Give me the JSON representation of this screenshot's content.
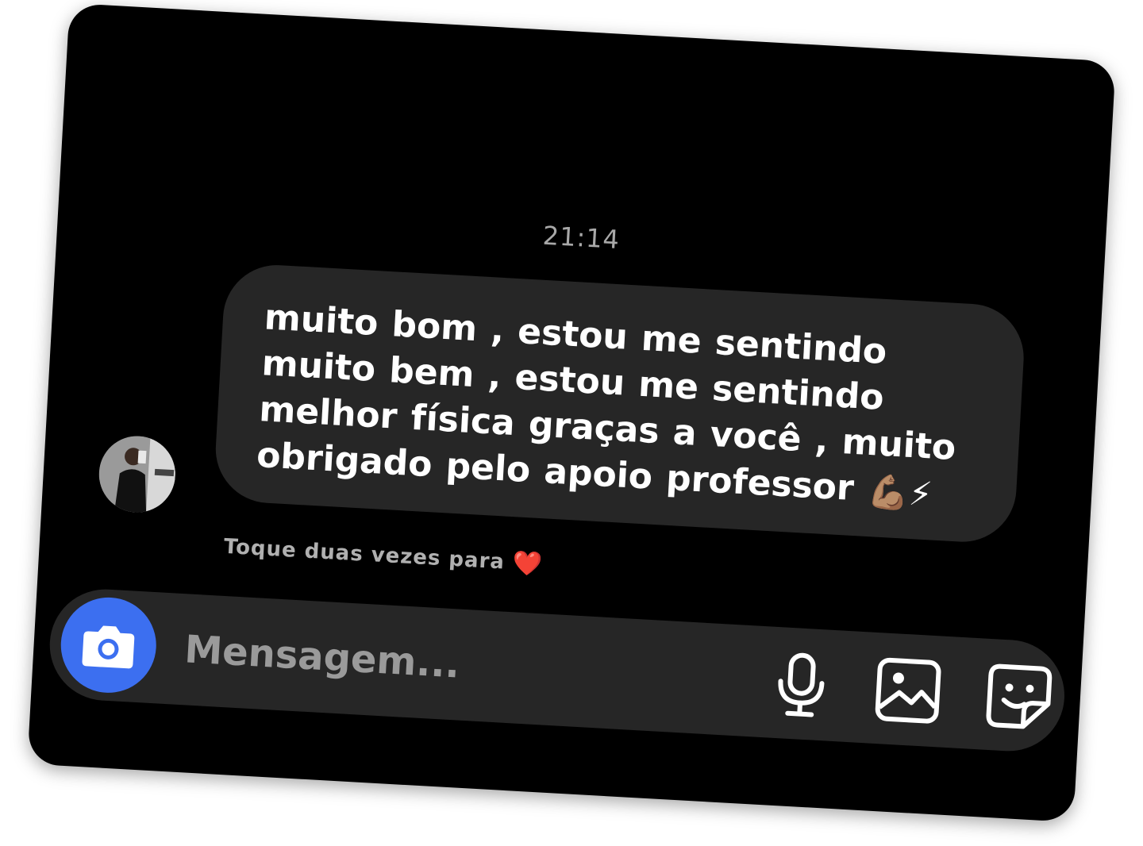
{
  "conversation": {
    "timestamp": "21:14",
    "message": {
      "text": "muito bom , estou me sentindo muito bem , estou me sentindo melhor física graças a você , muito obrigado pelo apoio professor",
      "emojis": "💪🏽⚡"
    },
    "hint": {
      "text": "Toque duas vezes para",
      "heart": "❤️"
    }
  },
  "composer": {
    "placeholder": "Mensagem...",
    "camera_icon": "camera-icon",
    "mic_icon": "microphone-icon",
    "gallery_icon": "image-gallery-icon",
    "sticker_icon": "sticker-icon"
  },
  "colors": {
    "background": "#000000",
    "bubble": "#262626",
    "accent": "#3c6ff0",
    "text": "#ffffff",
    "muted": "#a8a8a8",
    "heart": "#e0162b"
  }
}
